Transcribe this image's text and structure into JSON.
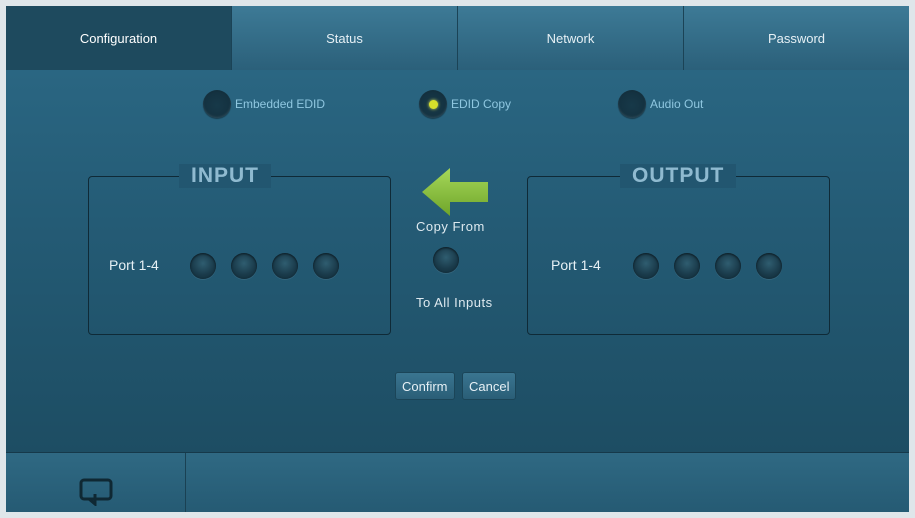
{
  "tabs": [
    {
      "label": "Configuration",
      "active": true
    },
    {
      "label": "Status",
      "active": false
    },
    {
      "label": "Network",
      "active": false
    },
    {
      "label": "Password",
      "active": false
    }
  ],
  "modes": {
    "embedded": {
      "label": "Embedded EDID",
      "selected": false
    },
    "copy": {
      "label": "EDID Copy",
      "selected": true
    },
    "audio": {
      "label": "Audio Out",
      "selected": false
    }
  },
  "input_panel": {
    "title": "INPUT",
    "port_label": "Port 1-4"
  },
  "output_panel": {
    "title": "OUTPUT",
    "port_label": "Port 1-4"
  },
  "copy": {
    "from_label": "Copy From",
    "to_all_label": "To All Inputs"
  },
  "actions": {
    "confirm_label": "Confirm",
    "cancel_label": "Cancel"
  },
  "colors": {
    "accent_selected": "#d7e02b",
    "arrow": "#8cc63f",
    "background": "#1f4a5f"
  },
  "icons": {
    "arrow": "left-arrow-icon",
    "back": "return-icon"
  }
}
